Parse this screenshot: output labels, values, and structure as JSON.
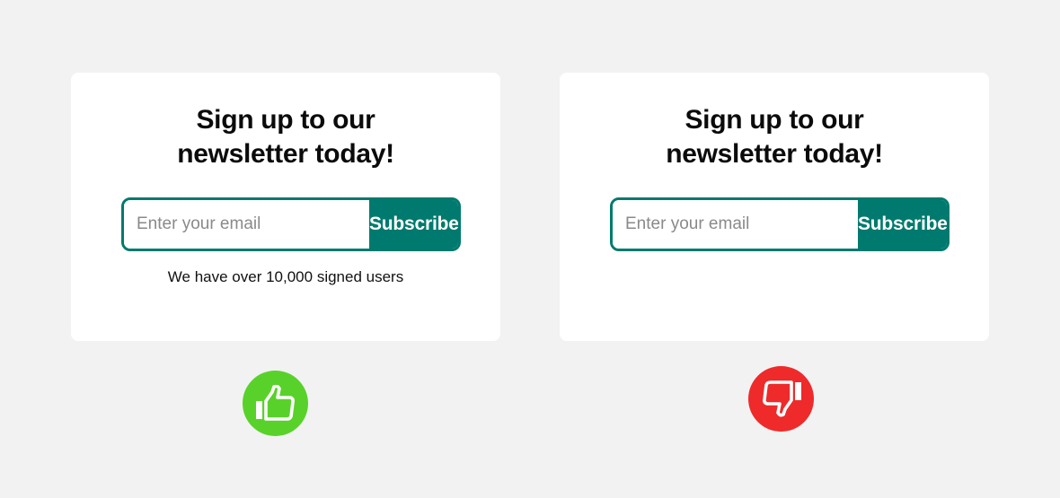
{
  "good_example": {
    "title_line1": "Sign up to our",
    "title_line2": "newsletter today!",
    "email_placeholder": "Enter your email",
    "subscribe_label": "Subscribe",
    "social_proof": "We have over 10,000 signed users",
    "verdict_icon": "thumbs-up-icon",
    "verdict_color": "#58d22a"
  },
  "bad_example": {
    "title_line1": "Sign up to our",
    "title_line2": "newsletter today!",
    "email_placeholder": "Enter your email",
    "subscribe_label": "Subscribe",
    "verdict_icon": "thumbs-down-icon",
    "verdict_color": "#ee2a2a"
  },
  "colors": {
    "background": "#f2f2f2",
    "card": "#ffffff",
    "accent": "#007a6e"
  }
}
